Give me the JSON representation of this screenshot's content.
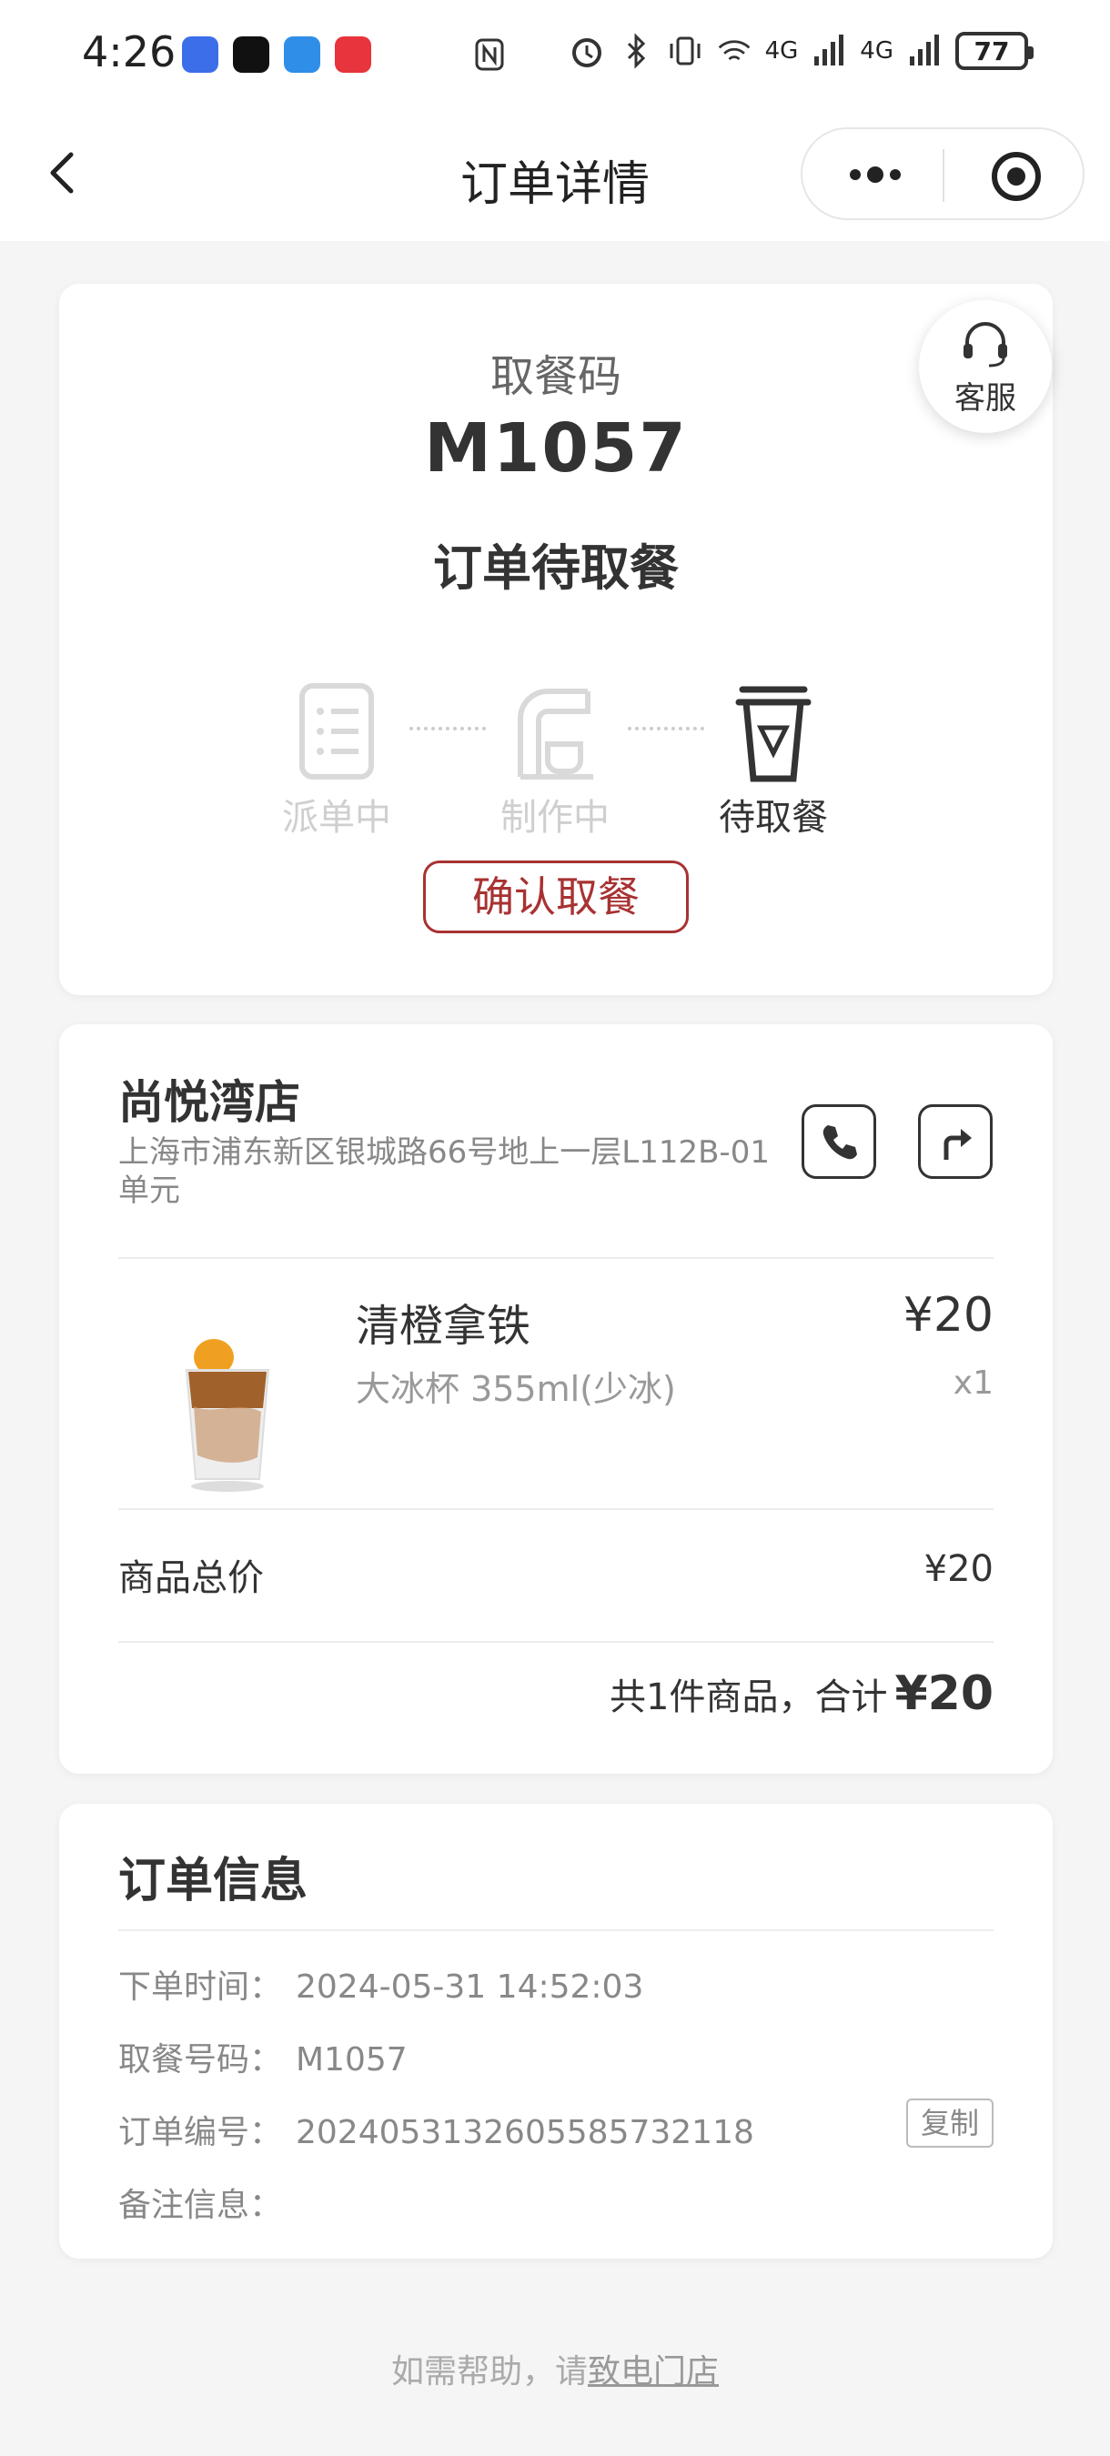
{
  "status_bar": {
    "time": "4:26",
    "network_1": "4G",
    "network_2": "4G",
    "battery": "77"
  },
  "navbar": {
    "title": "订单详情"
  },
  "pickup": {
    "label": "取餐码",
    "code": "M1057",
    "status": "订单待取餐",
    "service_label": "客服",
    "steps": [
      {
        "label": "派单中",
        "state": "inactive"
      },
      {
        "label": "制作中",
        "state": "inactive"
      },
      {
        "label": "待取餐",
        "state": "active"
      }
    ],
    "confirm_label": "确认取餐"
  },
  "store": {
    "name": "尚悦湾店",
    "address": "上海市浦东新区银城路66号地上一层L112B-01单元",
    "product": {
      "name": "清橙拿铁",
      "spec": "大冰杯 355ml(少冰)",
      "price": "¥20",
      "qty": "x1"
    },
    "subtotal_label": "商品总价",
    "subtotal_value": "¥20",
    "total_prefix": "共1件商品，合计",
    "total_amount": "¥20"
  },
  "order_info": {
    "title": "订单信息",
    "rows": [
      {
        "key": "下单时间：",
        "value": "2024-05-31 14:52:03"
      },
      {
        "key": "取餐号码：",
        "value": "M1057"
      },
      {
        "key": "订单编号：",
        "value": "2024053132605585732118"
      },
      {
        "key": "备注信息：",
        "value": ""
      }
    ],
    "copy_label": "复制"
  },
  "footer": {
    "prefix": "如需帮助，请",
    "link": "致电门店"
  },
  "colors": {
    "accent": "#a83232",
    "background": "#f5f5f5"
  }
}
